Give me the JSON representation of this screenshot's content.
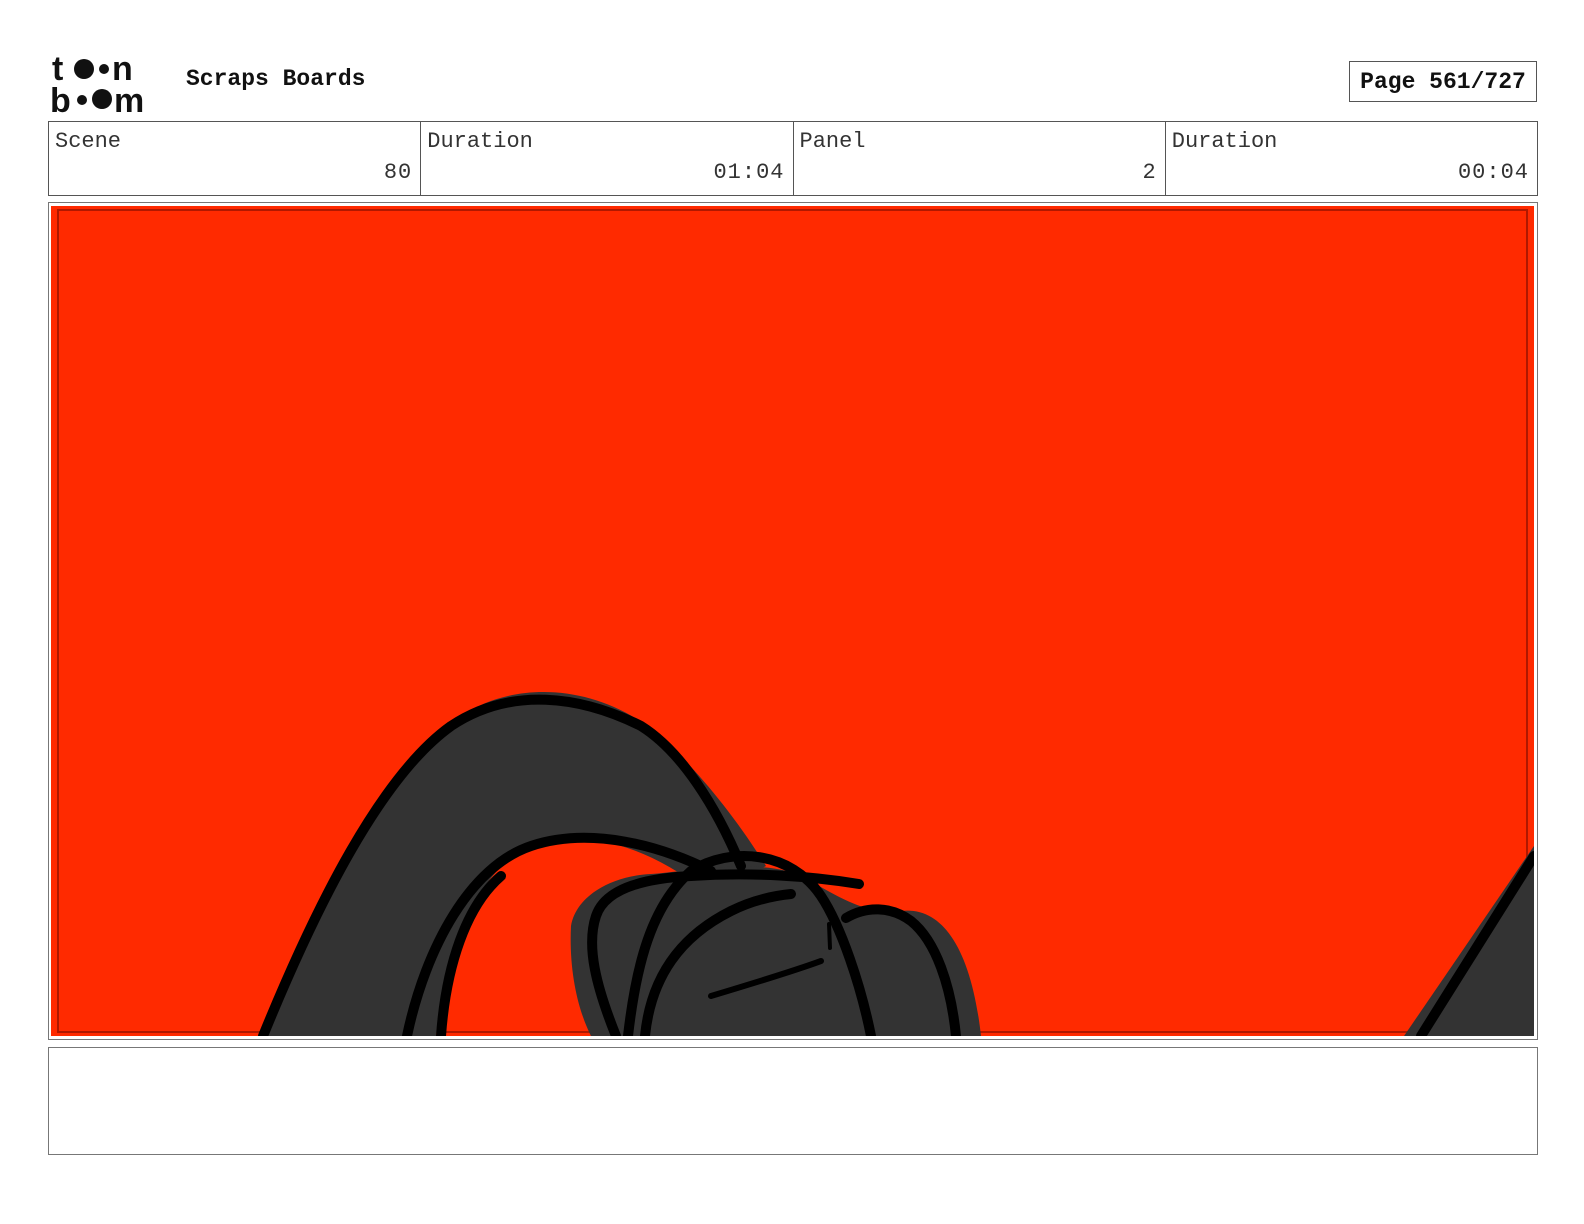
{
  "header": {
    "logo_text": [
      "t",
      "n",
      "b",
      "m"
    ],
    "project_title": "Scraps Boards",
    "page_label": "Page 561/727"
  },
  "info": {
    "scene": {
      "label": "Scene",
      "value": "80"
    },
    "scene_duration": {
      "label": "Duration",
      "value": "01:04"
    },
    "panel": {
      "label": "Panel",
      "value": "2"
    },
    "panel_duration": {
      "label": "Duration",
      "value": "00:04"
    }
  },
  "panel_image": {
    "background_color": "#ff2a00",
    "shape_fill_color": "#333333",
    "line_color": "#000000"
  },
  "notes": {
    "text": ""
  }
}
